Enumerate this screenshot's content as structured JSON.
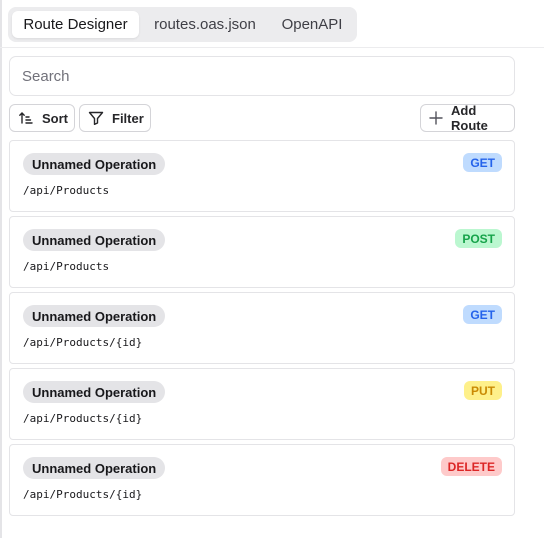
{
  "tabs": [
    {
      "label": "Route Designer",
      "active": true
    },
    {
      "label": "routes.oas.json",
      "active": false
    },
    {
      "label": "OpenAPI",
      "active": false
    }
  ],
  "search": {
    "placeholder": "Search",
    "value": ""
  },
  "toolbar": {
    "sort_label": "Sort",
    "filter_label": "Filter",
    "add_label": "Add Route",
    "sort_icon": "sort-ascending-icon",
    "filter_icon": "filter-funnel-icon",
    "add_icon": "plus-icon"
  },
  "method_colors": {
    "GET": {
      "bg": "#bfdbfe",
      "fg": "#2563eb"
    },
    "POST": {
      "bg": "#bbf7d0",
      "fg": "#16a34a"
    },
    "PUT": {
      "bg": "#fef08a",
      "fg": "#ca8a04"
    },
    "DELETE": {
      "bg": "#fecaca",
      "fg": "#dc2626"
    }
  },
  "routes": [
    {
      "name": "Unnamed Operation",
      "method": "GET",
      "path": "/api/Products"
    },
    {
      "name": "Unnamed Operation",
      "method": "POST",
      "path": "/api/Products"
    },
    {
      "name": "Unnamed Operation",
      "method": "GET",
      "path": "/api/Products/{id}"
    },
    {
      "name": "Unnamed Operation",
      "method": "PUT",
      "path": "/api/Products/{id}"
    },
    {
      "name": "Unnamed Operation",
      "method": "DELETE",
      "path": "/api/Products/{id}"
    }
  ]
}
